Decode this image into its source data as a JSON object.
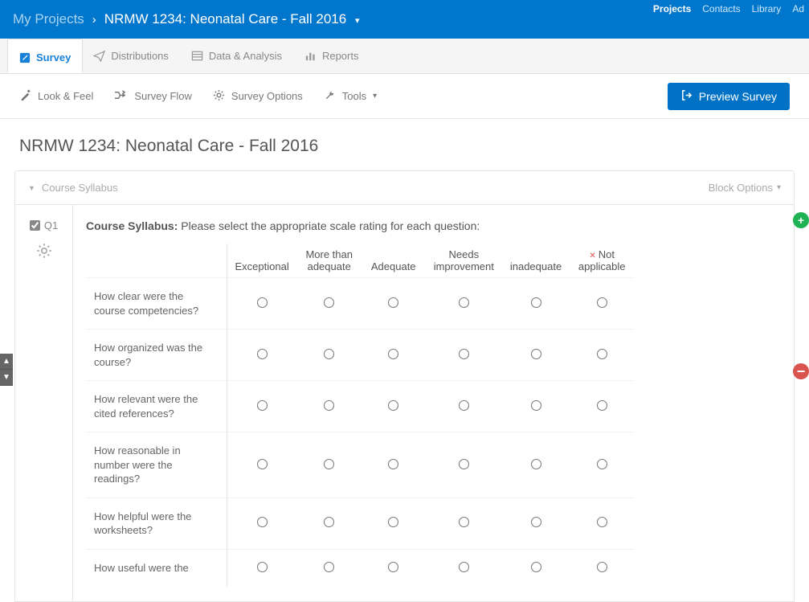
{
  "header": {
    "my_projects": "My Projects",
    "project_name": "NRMW 1234: Neonatal Care - Fall 2016",
    "links": [
      "Projects",
      "Contacts",
      "Library",
      "Ad"
    ]
  },
  "tabs": [
    {
      "label": "Survey",
      "active": true
    },
    {
      "label": "Distributions"
    },
    {
      "label": "Data & Analysis"
    },
    {
      "label": "Reports"
    }
  ],
  "toolbar": {
    "look_feel": "Look & Feel",
    "survey_flow": "Survey Flow",
    "survey_options": "Survey Options",
    "tools": "Tools",
    "preview": "Preview Survey"
  },
  "page_title": "NRMW 1234: Neonatal Care - Fall 2016",
  "block": {
    "name": "Course Syllabus",
    "options_label": "Block Options"
  },
  "question": {
    "number": "Q1",
    "prefix": "Course Syllabus:",
    "prompt": " Please select the appropriate scale rating for each question:",
    "columns": [
      "Exceptional",
      "More than adequate",
      "Adequate",
      "Needs improvement",
      "inadequate",
      "Not applicable"
    ],
    "rows": [
      "How clear were the course competencies?",
      "How organized was the course?",
      "How relevant were the cited references?",
      "How reasonable in number were the readings?",
      "How helpful were the worksheets?",
      "How useful were the"
    ]
  }
}
